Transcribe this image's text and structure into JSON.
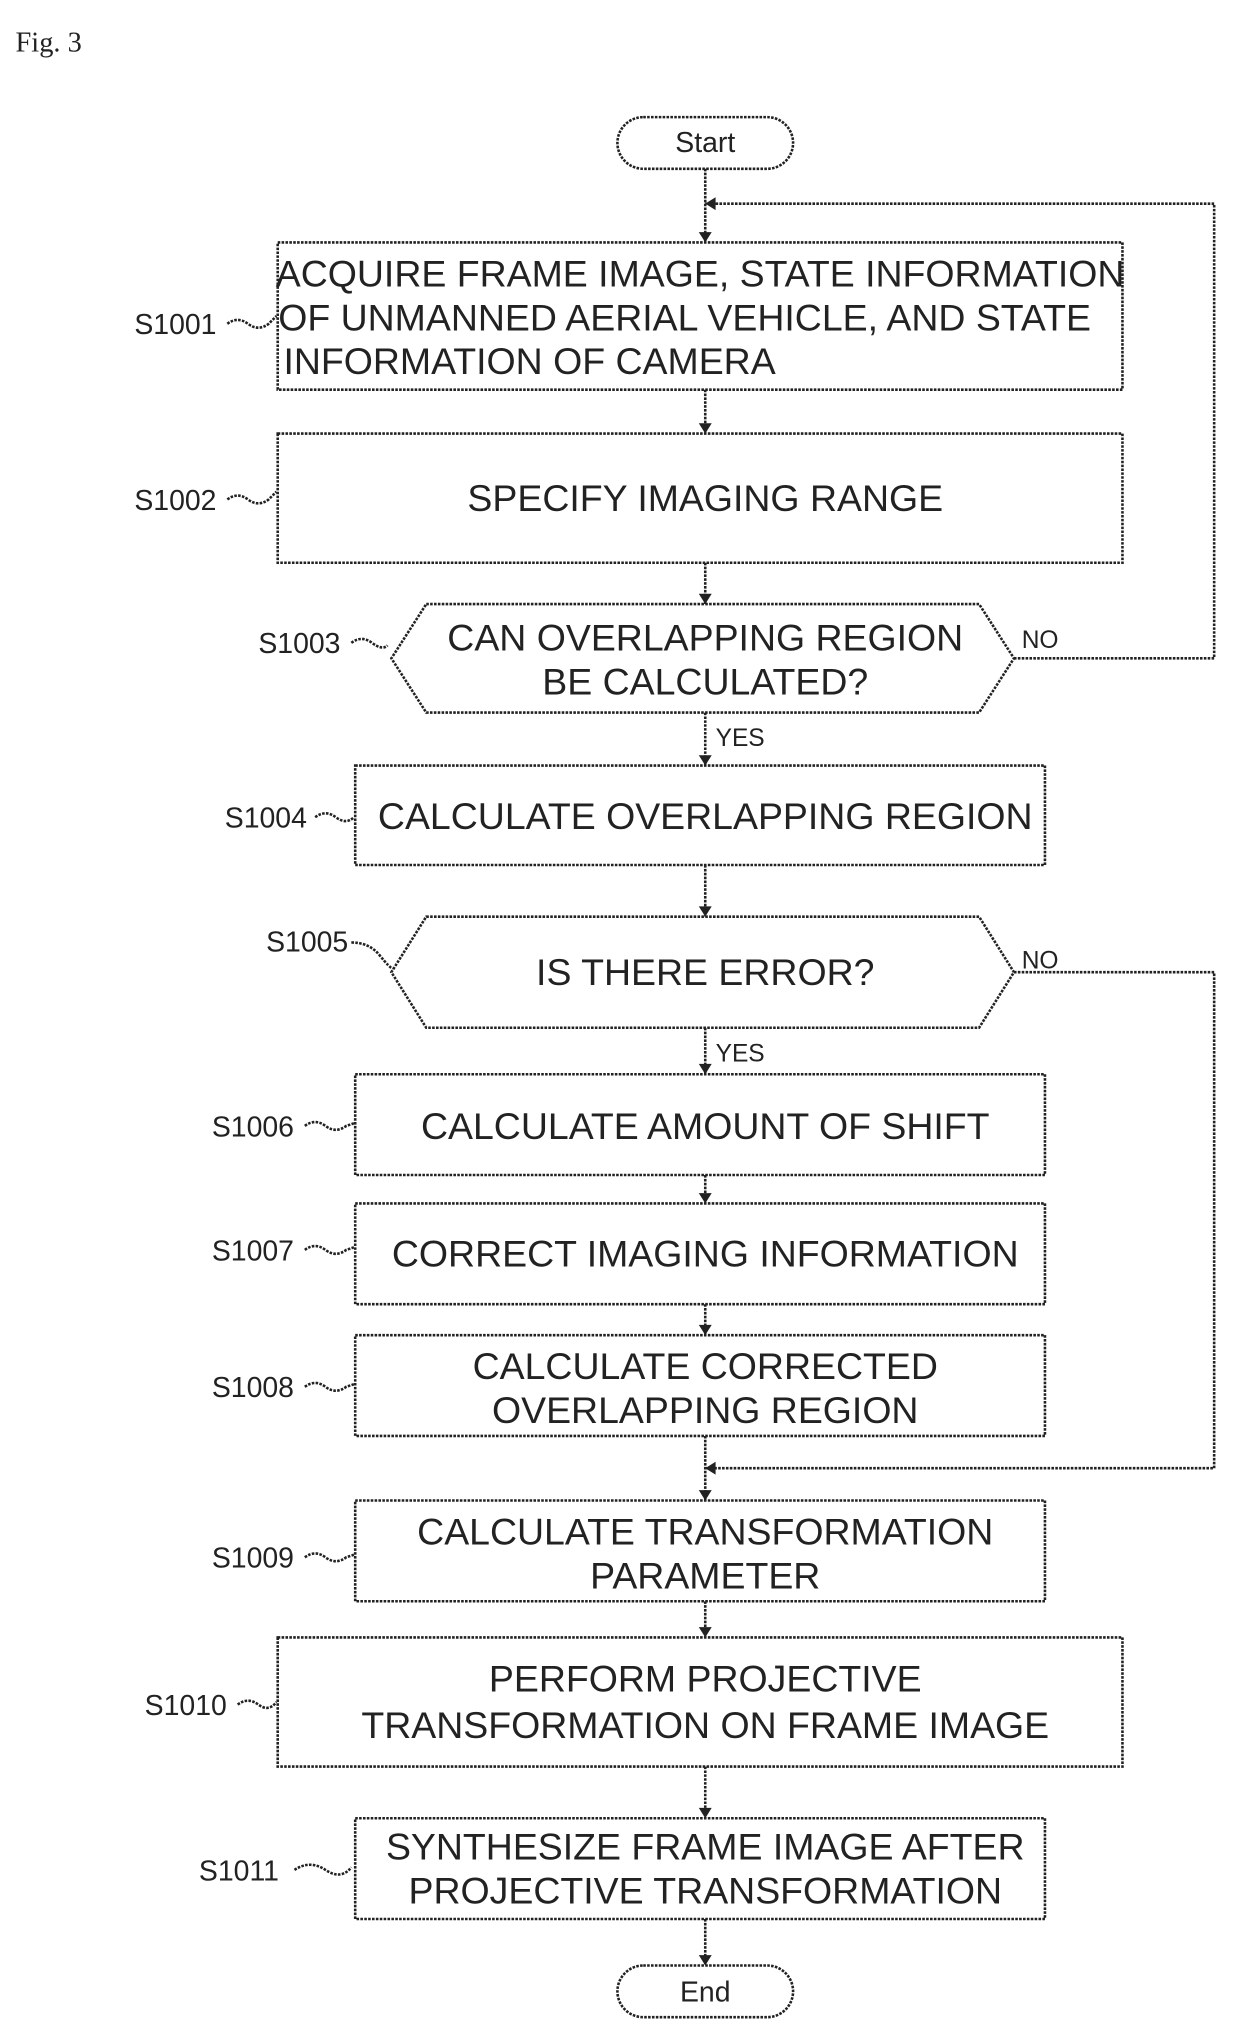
{
  "figure_label": "Fig. 3",
  "start": "Start",
  "end": "End",
  "steps": [
    {
      "id": "S1001",
      "lines": [
        "ACQUIRE FRAME IMAGE, STATE INFORMATION",
        "OF UNMANNED AERIAL VEHICLE, AND STATE",
        "INFORMATION OF CAMERA"
      ]
    },
    {
      "id": "S1002",
      "lines": [
        "SPECIFY IMAGING RANGE"
      ]
    },
    {
      "id": "S1003",
      "lines": [
        "CAN OVERLAPPING REGION",
        "BE CALCULATED?"
      ],
      "yes": "YES",
      "no": "NO"
    },
    {
      "id": "S1004",
      "lines": [
        "CALCULATE OVERLAPPING REGION"
      ]
    },
    {
      "id": "S1005",
      "lines": [
        "IS THERE ERROR?"
      ],
      "yes": "YES",
      "no": "NO"
    },
    {
      "id": "S1006",
      "lines": [
        "CALCULATE AMOUNT OF SHIFT"
      ]
    },
    {
      "id": "S1007",
      "lines": [
        "CORRECT IMAGING INFORMATION"
      ]
    },
    {
      "id": "S1008",
      "lines": [
        "CALCULATE CORRECTED",
        "OVERLAPPING REGION"
      ]
    },
    {
      "id": "S1009",
      "lines": [
        "CALCULATE TRANSFORMATION",
        "PARAMETER"
      ]
    },
    {
      "id": "S1010",
      "lines": [
        "PERFORM PROJECTIVE",
        "TRANSFORMATION ON FRAME IMAGE"
      ]
    },
    {
      "id": "S1011",
      "lines": [
        "SYNTHESIZE FRAME IMAGE AFTER",
        "PROJECTIVE TRANSFORMATION"
      ]
    }
  ]
}
